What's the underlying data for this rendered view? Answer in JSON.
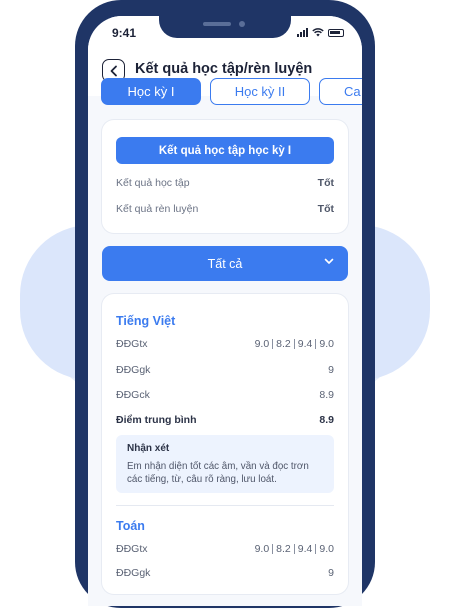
{
  "status_bar": {
    "time": "9:41"
  },
  "header": {
    "title": "Kết quả học tập/rèn luyện"
  },
  "tabs": [
    {
      "label": "Học kỳ I",
      "active": true
    },
    {
      "label": "Học kỳ II",
      "active": false
    },
    {
      "label": "Ca",
      "active": false
    }
  ],
  "summary": {
    "button_label": "Kết quả học tập học kỳ I",
    "rows": [
      {
        "label": "Kết quả học tập",
        "value": "Tốt"
      },
      {
        "label": "Kết quả rèn luyện",
        "value": "Tốt"
      }
    ]
  },
  "filter": {
    "label": "Tất cả"
  },
  "subjects": [
    {
      "name": "Tiếng Việt",
      "rows": [
        {
          "label": "ĐĐGtx",
          "scores": [
            "9.0",
            "8.2",
            "9.4",
            "9.0"
          ]
        },
        {
          "label": "ĐĐGgk",
          "value": "9"
        },
        {
          "label": "ĐĐGck",
          "value": "8.9"
        },
        {
          "label": "Điểm trung bình",
          "value": "8.9"
        }
      ],
      "comment": {
        "title": "Nhận xét",
        "text": "Em nhận diện tốt các âm, vần và đọc trơn các tiếng, từ, câu rõ ràng, lưu loát."
      }
    },
    {
      "name": "Toán",
      "rows": [
        {
          "label": "ĐĐGtx",
          "scores": [
            "9.0",
            "8.2",
            "9.4",
            "9.0"
          ]
        },
        {
          "label": "ĐĐGgk",
          "value": "9"
        }
      ]
    }
  ],
  "colors": {
    "primary": "#3b7bef",
    "phone_frame": "#1f3566",
    "text_dark": "#1c2237"
  }
}
